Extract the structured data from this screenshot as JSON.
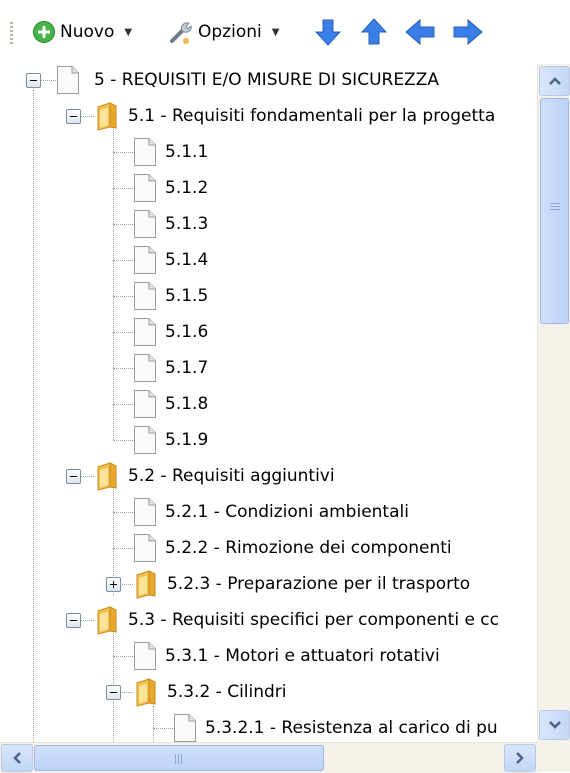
{
  "toolbar": {
    "new_label": "Nuovo",
    "options_label": "Opzioni"
  },
  "tree": {
    "root": "5 - REQUISITI E/O MISURE DI SICUREZZA",
    "n51": "5.1 - Requisiti fondamentali per la progetta",
    "n511": "5.1.1",
    "n512": "5.1.2",
    "n513": "5.1.3",
    "n514": "5.1.4",
    "n515": "5.1.5",
    "n516": "5.1.6",
    "n517": "5.1.7",
    "n518": "5.1.8",
    "n519": "5.1.9",
    "n52": "5.2 - Requisiti aggiuntivi",
    "n521": "5.2.1 - Condizioni ambientali",
    "n522": "5.2.2 - Rimozione dei componenti",
    "n523": "5.2.3 - Preparazione per il trasporto",
    "n53": "5.3 - Requisiti specifici per componenti e cc",
    "n531": "5.3.1 - Motori e attuatori rotativi",
    "n532": "5.3.2 - Cilindri",
    "n5321": "5.3.2.1 - Resistenza al carico di pu"
  },
  "icons": {
    "new": "plus-circle-icon",
    "options": "wrench-icon",
    "down": "arrow-down-icon",
    "up": "arrow-up-icon",
    "left": "arrow-left-icon",
    "right": "arrow-right-icon",
    "document": "document-icon",
    "folder": "folder-icon"
  },
  "colors": {
    "arrow_blue": "#3a7ee8",
    "new_green": "#3aa83a",
    "folder_yellow": "#f2c14e",
    "scrollbar_blue": "#c3d6f5"
  }
}
